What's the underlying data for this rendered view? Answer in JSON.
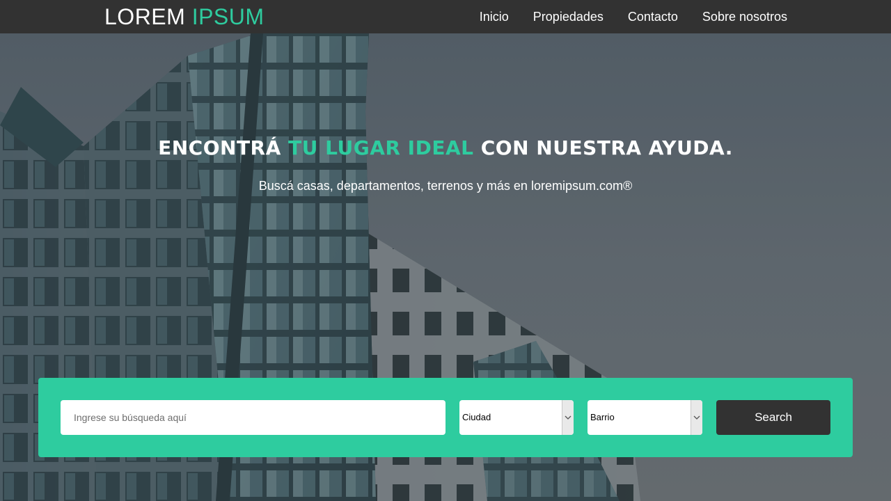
{
  "brand": {
    "logo_part1": "LOREM",
    "logo_part2": "IPSUM",
    "accent_color": "#2ecc9f",
    "dark_color": "#323232"
  },
  "nav": {
    "items": [
      {
        "label": "Inicio"
      },
      {
        "label": "Propiedades"
      },
      {
        "label": "Contacto"
      },
      {
        "label": "Sobre nosotros"
      }
    ]
  },
  "hero": {
    "title_part1": "Encontrá",
    "title_accent": "tu lugar ideal",
    "title_part2": "con nuestra ayuda.",
    "subtitle": "Buscá casas, departamentos, terrenos y más en loremipsum.com®",
    "background_image": "building-photo"
  },
  "search": {
    "input_placeholder": "Ingrese su búsqueda aquí",
    "input_value": "",
    "city_select": {
      "selected": "Ciudad",
      "icon": "chevron-down-icon"
    },
    "barrio_select": {
      "selected": "Barrio",
      "icon": "chevron-down-icon"
    },
    "button_label": "Search"
  }
}
